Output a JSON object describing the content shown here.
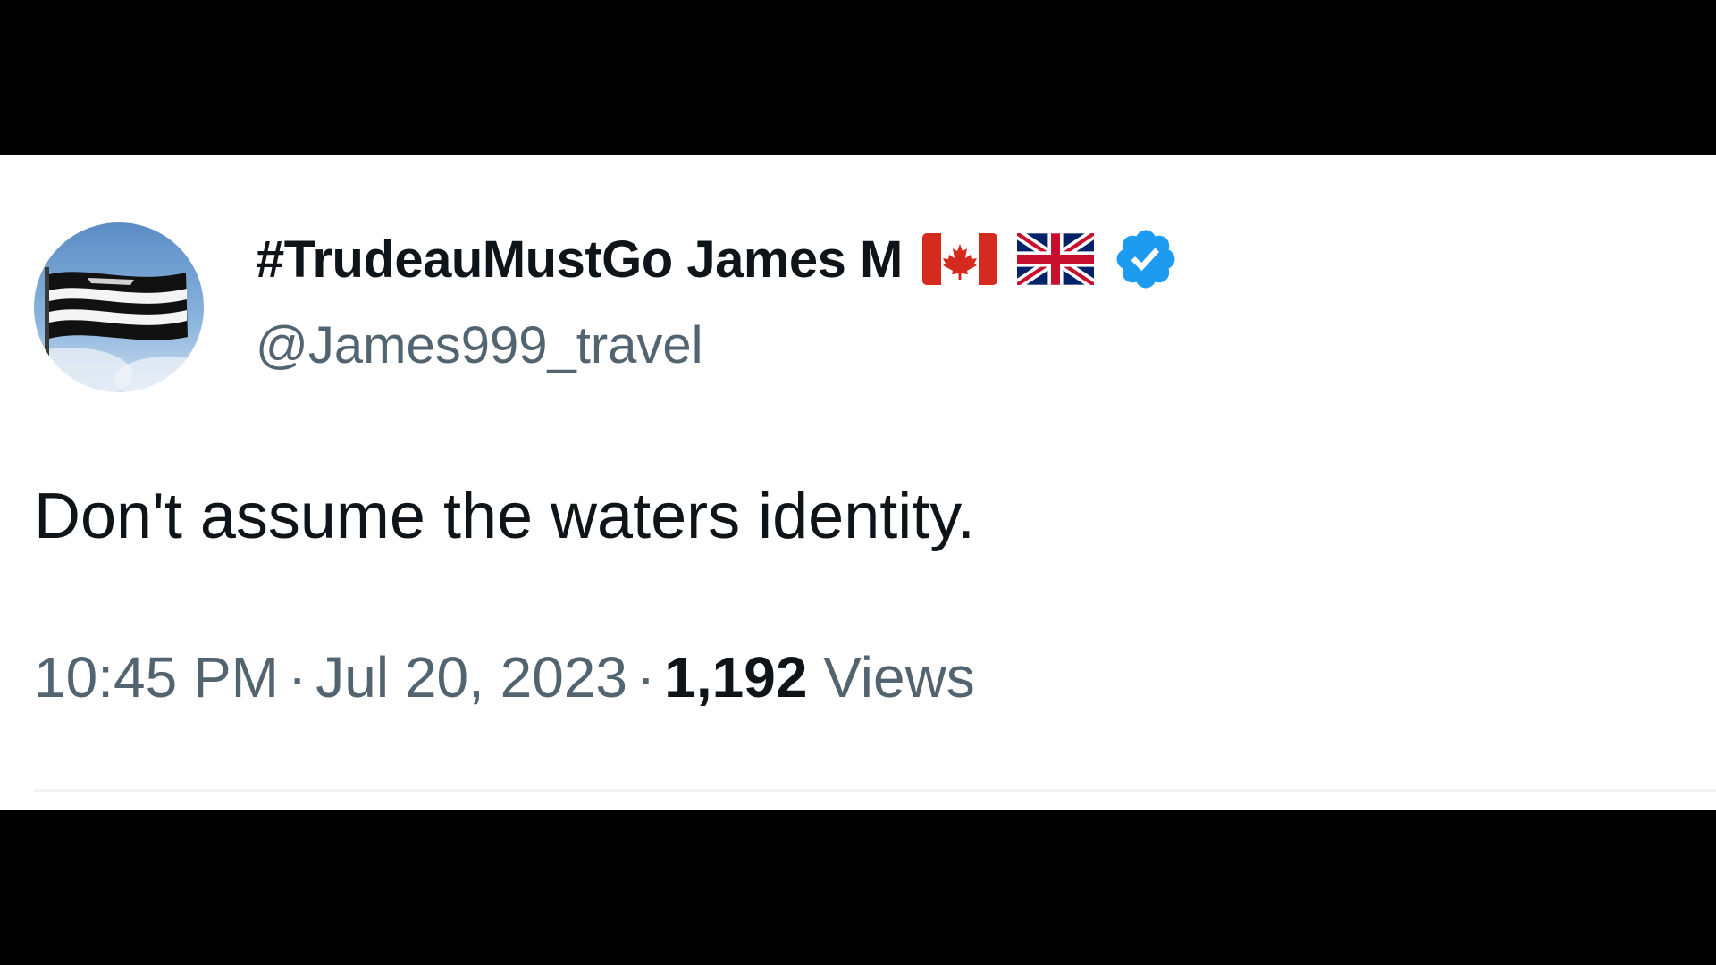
{
  "tweet": {
    "display_name": "#TrudeauMustGo James M",
    "flags": [
      "canada-flag",
      "united-kingdom-flag"
    ],
    "verified": true,
    "handle": "@James999_travel",
    "text": "Don't assume the waters identity.",
    "time": "10:45 PM",
    "separator": "·",
    "date": "Jul 20, 2023",
    "views_count": "1,192",
    "views_label": "Views"
  },
  "icons": {
    "verified": "verified-badge-icon",
    "avatar": "flag-avatar-image"
  },
  "colors": {
    "text_primary": "#0f1419",
    "text_secondary": "#536471",
    "verified_blue": "#1d9bf0",
    "canada_red": "#d52b1e",
    "uk_blue": "#012169",
    "uk_red": "#c8102e"
  }
}
